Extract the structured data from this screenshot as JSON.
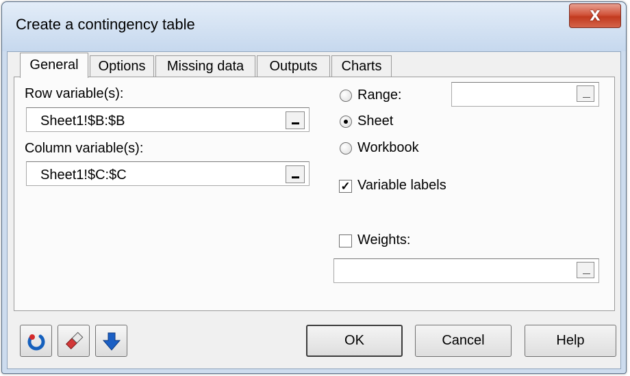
{
  "window": {
    "title": "Create a contingency table",
    "close_glyph": "X"
  },
  "tabs": [
    {
      "label": "General",
      "active": true
    },
    {
      "label": "Options",
      "active": false
    },
    {
      "label": "Missing data",
      "active": false
    },
    {
      "label": "Outputs",
      "active": false
    },
    {
      "label": "Charts",
      "active": false
    }
  ],
  "general": {
    "row_variables": {
      "label": "Row variable(s):",
      "value": "Sheet1!$B:$B"
    },
    "column_variables": {
      "label": "Column variable(s):",
      "value": "Sheet1!$C:$C"
    },
    "output_location": {
      "options": [
        {
          "label": "Range:",
          "selected": false
        },
        {
          "label": "Sheet",
          "selected": true
        },
        {
          "label": "Workbook",
          "selected": false
        }
      ],
      "range_value": ""
    },
    "variable_labels": {
      "label": "Variable labels",
      "checked": true
    },
    "weights": {
      "label": "Weights:",
      "checked": false,
      "value": ""
    }
  },
  "footer": {
    "icons": [
      "reset-icon",
      "eraser-icon",
      "arrow-down-icon"
    ],
    "ok_label": "OK",
    "cancel_label": "Cancel",
    "help_label": "Help"
  },
  "colors": {
    "frame": "#cddcee",
    "close_button": "#c94a31",
    "reset_icon": "#1560bd",
    "arrow_icon": "#1a5fc4",
    "eraser_icon": "#d23838"
  }
}
